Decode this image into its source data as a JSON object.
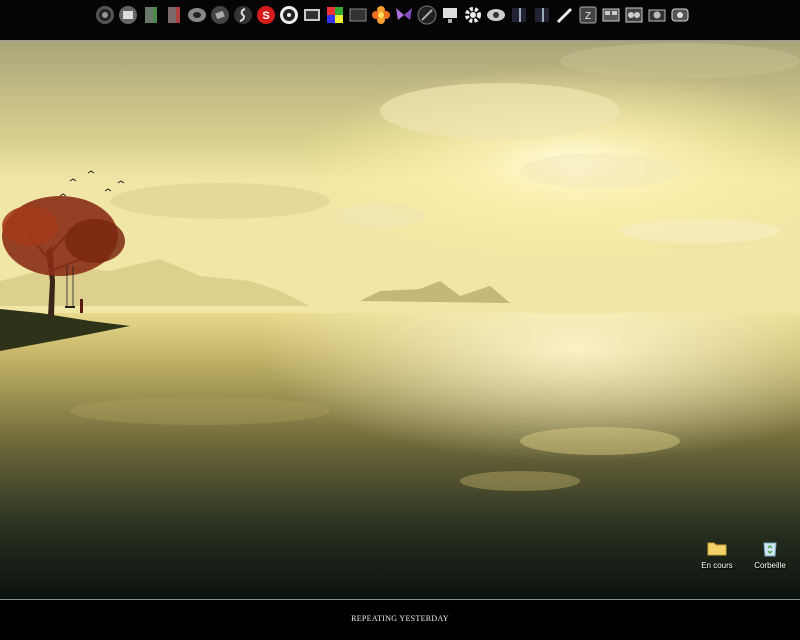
{
  "dock": {
    "icons": [
      "ubuntu-icon",
      "window-icon",
      "book-green-icon",
      "book-red-icon",
      "disc-icon",
      "media-icon",
      "flash-icon",
      "skype-icon",
      "radio-icon",
      "film-icon",
      "colorful-icon",
      "terminal-icon",
      "flower-icon",
      "butterfly-icon",
      "disk-dark-icon",
      "monitor-icon",
      "gear-icon",
      "eye-icon",
      "dark-window-icon",
      "dark-window2-icon",
      "pen-icon",
      "filezilla-icon",
      "gallery-icon",
      "film-reel-icon",
      "camera-icon",
      "webcam-icon"
    ],
    "accent": "#8a8a8a"
  },
  "desktop": {
    "icons": [
      {
        "label": "En cours",
        "icon": "folder-icon"
      },
      {
        "label": "Corbeille",
        "icon": "recycle-bin-icon"
      }
    ],
    "wallpaper_colors": {
      "sky_top": "#c7c48a",
      "sun": "#fffbd6",
      "water_dark": "#0d1712",
      "tree": "#8a2e16"
    }
  },
  "bottombar": {
    "title": "REPEATING YESTERDAY"
  }
}
